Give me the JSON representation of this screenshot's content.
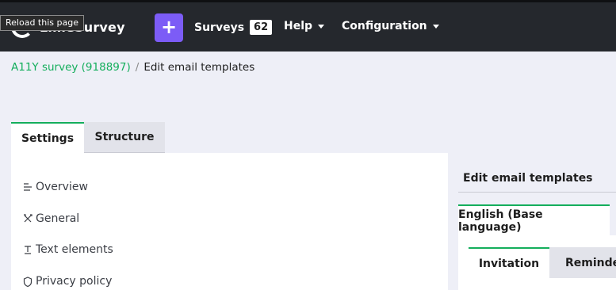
{
  "topbar": {
    "logo_text": "LimeSurvey",
    "tooltip": "Reload this page",
    "add_label": "+",
    "surveys_label": "Surveys",
    "surveys_count": "62",
    "help_label": "Help",
    "configuration_label": "Configuration"
  },
  "breadcrumb": {
    "survey": "A11Y survey (918897)",
    "separator": "/",
    "current": "Edit email templates"
  },
  "tabs": [
    {
      "label": "Settings",
      "active": true
    },
    {
      "label": "Structure",
      "active": false
    }
  ],
  "menu": [
    {
      "label": "Overview",
      "icon": "list-icon"
    },
    {
      "label": "General",
      "icon": "tools-icon"
    },
    {
      "label": "Text elements",
      "icon": "text-icon"
    },
    {
      "label": "Privacy policy",
      "icon": "shield-icon"
    }
  ],
  "right": {
    "title": "Edit email templates",
    "language_tab": "English (Base language)",
    "template_tabs": [
      {
        "label": "Invitation",
        "active": true
      },
      {
        "label": "Reminder",
        "active": false
      }
    ]
  },
  "colors": {
    "accent": "#14ae5c",
    "topbar": "#25282d",
    "add_button": "#7c5cf6"
  }
}
